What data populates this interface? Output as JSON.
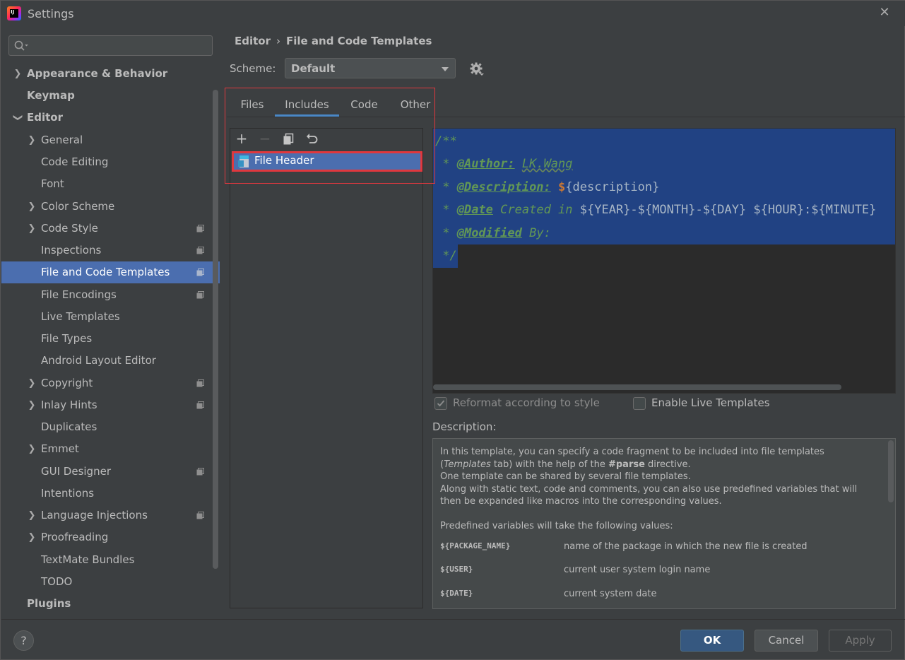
{
  "window": {
    "title": "Settings"
  },
  "search": {
    "placeholder": "",
    "value": ""
  },
  "sidebar": {
    "items": [
      {
        "label": "Appearance & Behavior"
      },
      {
        "label": "Keymap"
      },
      {
        "label": "Editor"
      },
      {
        "label": "General"
      },
      {
        "label": "Code Editing"
      },
      {
        "label": "Font"
      },
      {
        "label": "Color Scheme"
      },
      {
        "label": "Code Style"
      },
      {
        "label": "Inspections"
      },
      {
        "label": "File and Code Templates"
      },
      {
        "label": "File Encodings"
      },
      {
        "label": "Live Templates"
      },
      {
        "label": "File Types"
      },
      {
        "label": "Android Layout Editor"
      },
      {
        "label": "Copyright"
      },
      {
        "label": "Inlay Hints"
      },
      {
        "label": "Duplicates"
      },
      {
        "label": "Emmet"
      },
      {
        "label": "GUI Designer"
      },
      {
        "label": "Intentions"
      },
      {
        "label": "Language Injections"
      },
      {
        "label": "Proofreading"
      },
      {
        "label": "TextMate Bundles"
      },
      {
        "label": "TODO"
      },
      {
        "label": "Plugins"
      }
    ]
  },
  "breadcrumb": {
    "parent": "Editor",
    "current": "File and Code Templates"
  },
  "scheme": {
    "label": "Scheme:",
    "value": "Default"
  },
  "tabs": [
    {
      "label": "Files"
    },
    {
      "label": "Includes"
    },
    {
      "label": "Code"
    },
    {
      "label": "Other"
    }
  ],
  "templates": {
    "items": [
      {
        "label": "File Header"
      }
    ]
  },
  "editor": {
    "lines": {
      "l1": "/**",
      "author_tag": "@Author:",
      "author_val": "LK.Wang",
      "desc_tag": "@Description:",
      "desc_dollar": "$",
      "desc_var": "{description}",
      "date_tag": "@Date",
      "date_text": "Created in",
      "date_rest": "${YEAR}-${MONTH}-${DAY} ${HOUR}:${MINUTE}",
      "mod_tag": "@Modified",
      "mod_text": "By:",
      "end": "*/"
    }
  },
  "options": {
    "reformat": "Reformat according to style",
    "live": "Enable Live Templates"
  },
  "description": {
    "label": "Description:",
    "p1_a": "In this template, you can specify a code fragment to be included into file templates (",
    "p1_i": "Templates",
    "p1_b": " tab) with the help of the ",
    "p1_bold": "#parse",
    "p1_c": " directive.",
    "p2": "One template can be shared by several file templates.",
    "p3": "Along with static text, code and comments, you can also use predefined variables that will then be expanded like macros into the corresponding values.",
    "p4": "Predefined variables will take the following values:",
    "vars": [
      {
        "key": "${PACKAGE_NAME}",
        "value": "name of the package in which the new file is created"
      },
      {
        "key": "${USER}",
        "value": "current user system login name"
      },
      {
        "key": "${DATE}",
        "value": "current system date"
      }
    ]
  },
  "buttons": {
    "help": "?",
    "ok": "OK",
    "cancel": "Cancel",
    "apply": "Apply"
  }
}
